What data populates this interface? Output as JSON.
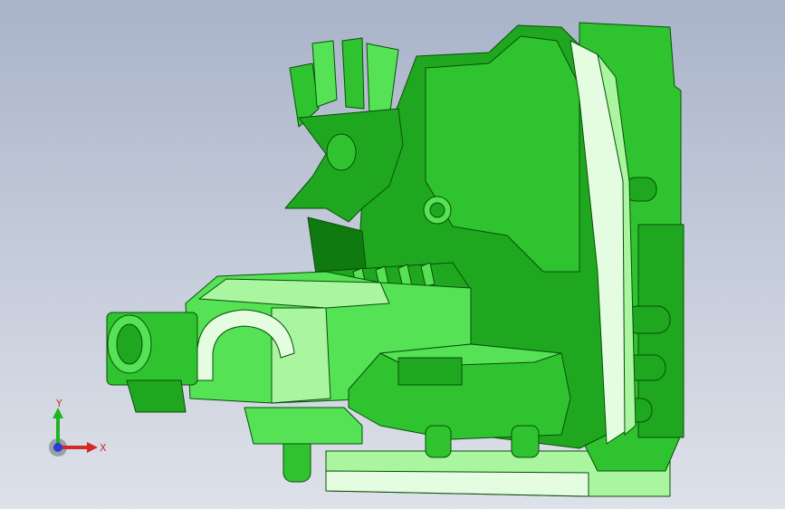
{
  "viewport": {
    "background_top": "#a9b3c9",
    "background_bottom": "#dde1e9"
  },
  "model": {
    "type": "3d-cad-assembly",
    "colors": {
      "dark": "#0f7a0f",
      "mid": "#1fa81f",
      "main": "#2fc42f",
      "bright": "#55e255",
      "light": "#a9f5a0",
      "pale": "#e4fde0",
      "edge": "#0a4d0a"
    }
  },
  "triad": {
    "y_label": "Y",
    "x_label": "X",
    "y_color": "#1fb51f",
    "x_color": "#d22a2a",
    "z_color": "#2a3fd2"
  }
}
